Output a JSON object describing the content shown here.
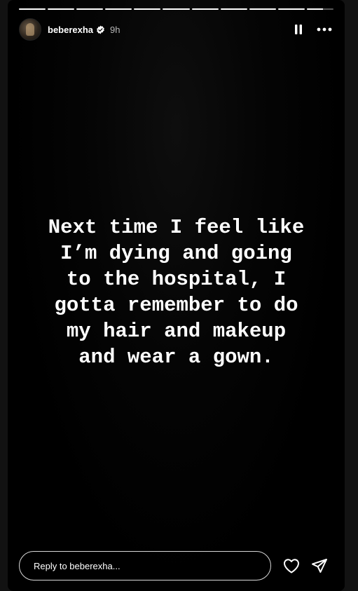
{
  "story": {
    "segment_count": 11,
    "current_segment": 11,
    "current_segment_progress": 0.6,
    "accent_color": "#ffffff",
    "background_color": "#000000"
  },
  "header": {
    "username": "beberexha",
    "verified": true,
    "time_ago": "9h",
    "avatar_icon": "avatar",
    "pause_icon": "pause-icon",
    "more_icon": "more-options-icon"
  },
  "caption": {
    "text": "Next time I feel like\nI’m dying and going\nto the hospital, I\ngotta remember to do\nmy hair and makeup\nand wear a gown."
  },
  "footer": {
    "reply_placeholder": "Reply to beberexha...",
    "like_icon": "heart-icon",
    "share_icon": "send-icon"
  }
}
